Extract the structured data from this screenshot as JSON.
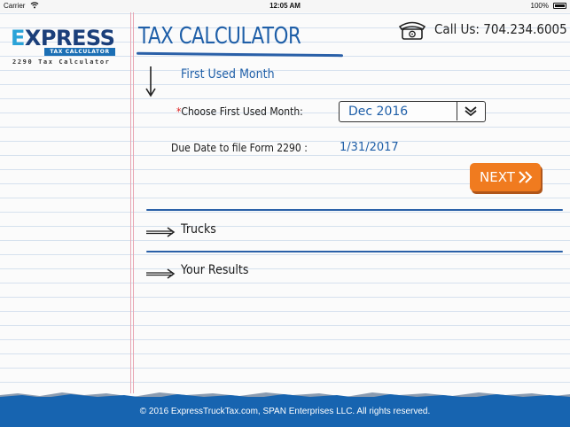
{
  "status_bar": {
    "carrier": "Carrier",
    "time": "12:05 AM",
    "battery": "100%"
  },
  "logo": {
    "word_first": "E",
    "word_rest": "XPRESS",
    "band": "TAX CALCULATOR",
    "tagline": "2290 Tax Calculator"
  },
  "header": {
    "title": "TAX CALCULATOR",
    "call_label": "Call Us:",
    "phone_number": "704.234.6005"
  },
  "sections": {
    "first_used": {
      "heading": "First Used Month",
      "required_marker": "*",
      "choose_label": "Choose First Used Month:",
      "selected_month": "Dec 2016",
      "due_label": "Due Date to file Form 2290 :",
      "due_value": "1/31/2017"
    },
    "trucks": {
      "heading": "Trucks"
    },
    "results": {
      "heading": "Your Results"
    }
  },
  "next_button": {
    "label": "NEXT"
  },
  "footer": {
    "copyright": "© 2016 ExpressTruckTax.com, SPAN Enterprises LLC. All rights reserved."
  },
  "colors": {
    "brand_blue": "#1f5fa8",
    "accent_orange": "#f07b1f",
    "footer_blue": "#1764b0"
  }
}
